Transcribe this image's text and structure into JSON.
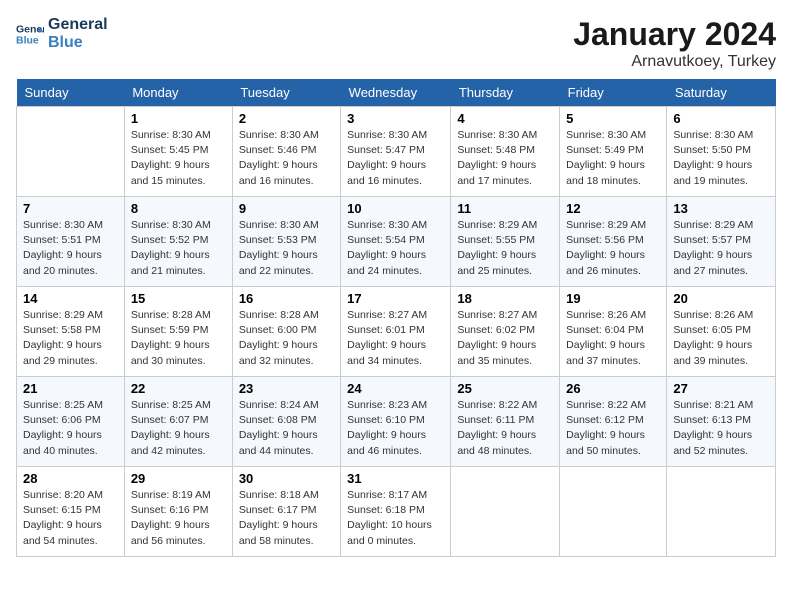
{
  "header": {
    "logo_line1": "General",
    "logo_line2": "Blue",
    "month_title": "January 2024",
    "location": "Arnavutkoey, Turkey"
  },
  "days_of_week": [
    "Sunday",
    "Monday",
    "Tuesday",
    "Wednesday",
    "Thursday",
    "Friday",
    "Saturday"
  ],
  "weeks": [
    [
      {
        "day": "",
        "info": ""
      },
      {
        "day": "1",
        "info": "Sunrise: 8:30 AM\nSunset: 5:45 PM\nDaylight: 9 hours\nand 15 minutes."
      },
      {
        "day": "2",
        "info": "Sunrise: 8:30 AM\nSunset: 5:46 PM\nDaylight: 9 hours\nand 16 minutes."
      },
      {
        "day": "3",
        "info": "Sunrise: 8:30 AM\nSunset: 5:47 PM\nDaylight: 9 hours\nand 16 minutes."
      },
      {
        "day": "4",
        "info": "Sunrise: 8:30 AM\nSunset: 5:48 PM\nDaylight: 9 hours\nand 17 minutes."
      },
      {
        "day": "5",
        "info": "Sunrise: 8:30 AM\nSunset: 5:49 PM\nDaylight: 9 hours\nand 18 minutes."
      },
      {
        "day": "6",
        "info": "Sunrise: 8:30 AM\nSunset: 5:50 PM\nDaylight: 9 hours\nand 19 minutes."
      }
    ],
    [
      {
        "day": "7",
        "info": "Sunrise: 8:30 AM\nSunset: 5:51 PM\nDaylight: 9 hours\nand 20 minutes."
      },
      {
        "day": "8",
        "info": "Sunrise: 8:30 AM\nSunset: 5:52 PM\nDaylight: 9 hours\nand 21 minutes."
      },
      {
        "day": "9",
        "info": "Sunrise: 8:30 AM\nSunset: 5:53 PM\nDaylight: 9 hours\nand 22 minutes."
      },
      {
        "day": "10",
        "info": "Sunrise: 8:30 AM\nSunset: 5:54 PM\nDaylight: 9 hours\nand 24 minutes."
      },
      {
        "day": "11",
        "info": "Sunrise: 8:29 AM\nSunset: 5:55 PM\nDaylight: 9 hours\nand 25 minutes."
      },
      {
        "day": "12",
        "info": "Sunrise: 8:29 AM\nSunset: 5:56 PM\nDaylight: 9 hours\nand 26 minutes."
      },
      {
        "day": "13",
        "info": "Sunrise: 8:29 AM\nSunset: 5:57 PM\nDaylight: 9 hours\nand 27 minutes."
      }
    ],
    [
      {
        "day": "14",
        "info": "Sunrise: 8:29 AM\nSunset: 5:58 PM\nDaylight: 9 hours\nand 29 minutes."
      },
      {
        "day": "15",
        "info": "Sunrise: 8:28 AM\nSunset: 5:59 PM\nDaylight: 9 hours\nand 30 minutes."
      },
      {
        "day": "16",
        "info": "Sunrise: 8:28 AM\nSunset: 6:00 PM\nDaylight: 9 hours\nand 32 minutes."
      },
      {
        "day": "17",
        "info": "Sunrise: 8:27 AM\nSunset: 6:01 PM\nDaylight: 9 hours\nand 34 minutes."
      },
      {
        "day": "18",
        "info": "Sunrise: 8:27 AM\nSunset: 6:02 PM\nDaylight: 9 hours\nand 35 minutes."
      },
      {
        "day": "19",
        "info": "Sunrise: 8:26 AM\nSunset: 6:04 PM\nDaylight: 9 hours\nand 37 minutes."
      },
      {
        "day": "20",
        "info": "Sunrise: 8:26 AM\nSunset: 6:05 PM\nDaylight: 9 hours\nand 39 minutes."
      }
    ],
    [
      {
        "day": "21",
        "info": "Sunrise: 8:25 AM\nSunset: 6:06 PM\nDaylight: 9 hours\nand 40 minutes."
      },
      {
        "day": "22",
        "info": "Sunrise: 8:25 AM\nSunset: 6:07 PM\nDaylight: 9 hours\nand 42 minutes."
      },
      {
        "day": "23",
        "info": "Sunrise: 8:24 AM\nSunset: 6:08 PM\nDaylight: 9 hours\nand 44 minutes."
      },
      {
        "day": "24",
        "info": "Sunrise: 8:23 AM\nSunset: 6:10 PM\nDaylight: 9 hours\nand 46 minutes."
      },
      {
        "day": "25",
        "info": "Sunrise: 8:22 AM\nSunset: 6:11 PM\nDaylight: 9 hours\nand 48 minutes."
      },
      {
        "day": "26",
        "info": "Sunrise: 8:22 AM\nSunset: 6:12 PM\nDaylight: 9 hours\nand 50 minutes."
      },
      {
        "day": "27",
        "info": "Sunrise: 8:21 AM\nSunset: 6:13 PM\nDaylight: 9 hours\nand 52 minutes."
      }
    ],
    [
      {
        "day": "28",
        "info": "Sunrise: 8:20 AM\nSunset: 6:15 PM\nDaylight: 9 hours\nand 54 minutes."
      },
      {
        "day": "29",
        "info": "Sunrise: 8:19 AM\nSunset: 6:16 PM\nDaylight: 9 hours\nand 56 minutes."
      },
      {
        "day": "30",
        "info": "Sunrise: 8:18 AM\nSunset: 6:17 PM\nDaylight: 9 hours\nand 58 minutes."
      },
      {
        "day": "31",
        "info": "Sunrise: 8:17 AM\nSunset: 6:18 PM\nDaylight: 10 hours\nand 0 minutes."
      },
      {
        "day": "",
        "info": ""
      },
      {
        "day": "",
        "info": ""
      },
      {
        "day": "",
        "info": ""
      }
    ]
  ]
}
